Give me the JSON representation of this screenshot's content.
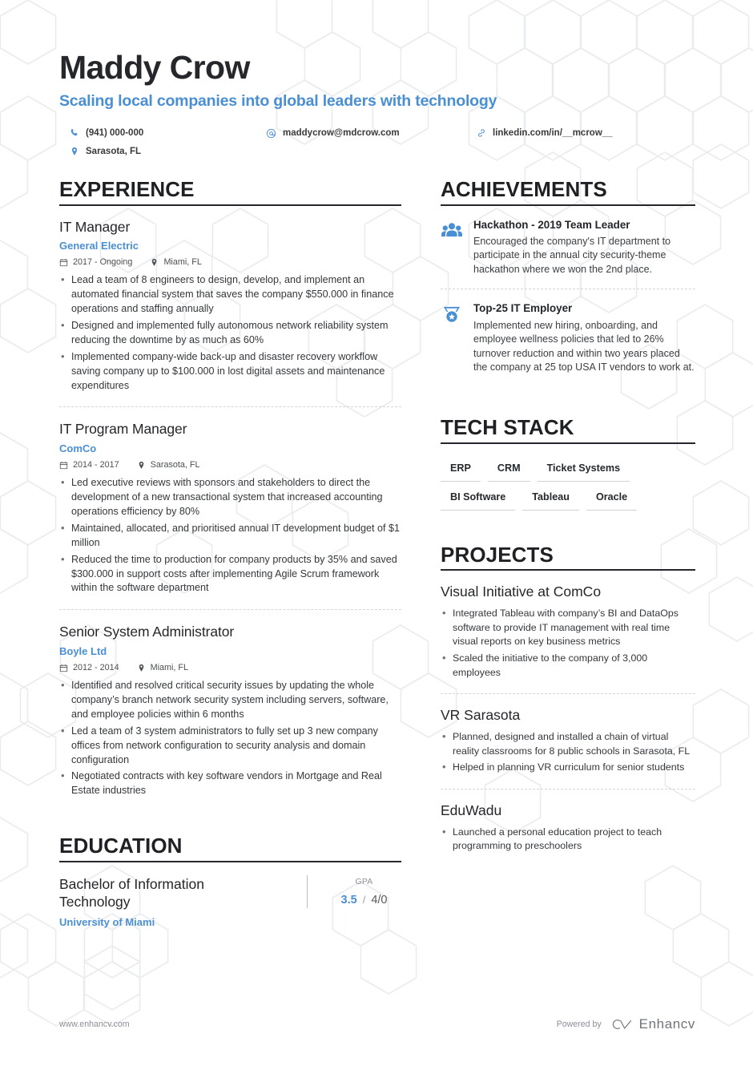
{
  "header": {
    "name": "Maddy Crow",
    "tagline": "Scaling local companies into global leaders with technology",
    "contacts": {
      "phone": "(941) 000-000",
      "email": "maddycrow@mdcrow.com",
      "linkedin": "linkedin.com/in/__mcrow__",
      "location": "Sarasota, FL"
    }
  },
  "colors": {
    "accent": "#4a8fd4",
    "heading": "#1f2023",
    "body": "#34373b",
    "muted": "#8b9096"
  },
  "sections": {
    "experience_title": "EXPERIENCE",
    "education_title": "EDUCATION",
    "achievements_title": "ACHIEVEMENTS",
    "techstack_title": "TECH STACK",
    "projects_title": "PROJECTS"
  },
  "experience": [
    {
      "role": "IT Manager",
      "company": "General Electric",
      "dates": "2017 - Ongoing",
      "location": "Miami, FL",
      "bullets": [
        "Lead a team of 8 engineers to design, develop, and implement an automated financial system that saves the company $550.000 in finance operations and staffing annually",
        "Designed and implemented fully autonomous network reliability system reducing the downtime by as much as 60%",
        "Implemented company-wide back-up and disaster recovery workflow saving company up to $100.000 in lost digital assets and maintenance expenditures"
      ]
    },
    {
      "role": "IT Program Manager",
      "company": "ComCo",
      "dates": "2014 - 2017",
      "location": "Sarasota, FL",
      "bullets": [
        "Led executive reviews with sponsors and stakeholders to direct the development of a new transactional system that increased accounting operations efficiency by 80%",
        "Maintained, allocated, and prioritised annual IT development budget of $1 million",
        "Reduced the time to production for company products by 35% and saved $300.000 in support costs after implementing Agile Scrum framework within the software department"
      ]
    },
    {
      "role": "Senior System Administrator",
      "company": "Boyle Ltd",
      "dates": "2012 - 2014",
      "location": "Miami, FL",
      "bullets": [
        "Identified and resolved critical security issues by updating the whole company’s branch network security system including servers, software, and employee policies within 6 months",
        "Led a team of 3 system administrators to fully set up 3 new company offices from network configuration to security analysis and domain configuration",
        "Negotiated contracts with key software vendors in Mortgage and Real Estate industries"
      ]
    }
  ],
  "education": [
    {
      "degree": "Bachelor of Information Technology",
      "school": "University of Miami",
      "gpa_label": "GPA",
      "gpa_score": "3.5",
      "gpa_separator": "/",
      "gpa_max": "4/0"
    }
  ],
  "achievements": [
    {
      "icon": "people-group-icon",
      "title": "Hackathon - 2019 Team Leader",
      "description": "Encouraged the company's IT department to participate in the annual city security-theme hackathon where we won the 2nd place."
    },
    {
      "icon": "medal-award-icon",
      "title": "Top-25 IT Employer",
      "description": "Implemented new hiring, onboarding, and employee wellness policies that led to 26% turnover reduction and within two years placed the company at 25 top USA IT vendors to work at."
    }
  ],
  "tech_stack": [
    "ERP",
    "CRM",
    "Ticket Systems",
    "BI Software",
    "Tableau",
    "Oracle"
  ],
  "projects": [
    {
      "title": "Visual Initiative at ComCo",
      "bullets": [
        "Integrated Tableau with company’s BI and DataOps software to provide IT management with real time visual reports on key business metrics",
        "Scaled the initiative to the company of 3,000 employees"
      ]
    },
    {
      "title": "VR Sarasota",
      "bullets": [
        "Planned, designed and installed a chain of virtual reality classrooms for 8 public schools in Sarasota, FL",
        "Helped in planning VR curriculum for senior students"
      ]
    },
    {
      "title": "EduWadu",
      "bullets": [
        "Launched a personal education project to teach programming to preschoolers"
      ]
    }
  ],
  "footer": {
    "url": "www.enhancv.com",
    "powered_by": "Powered by",
    "brand": "Enhancv"
  }
}
